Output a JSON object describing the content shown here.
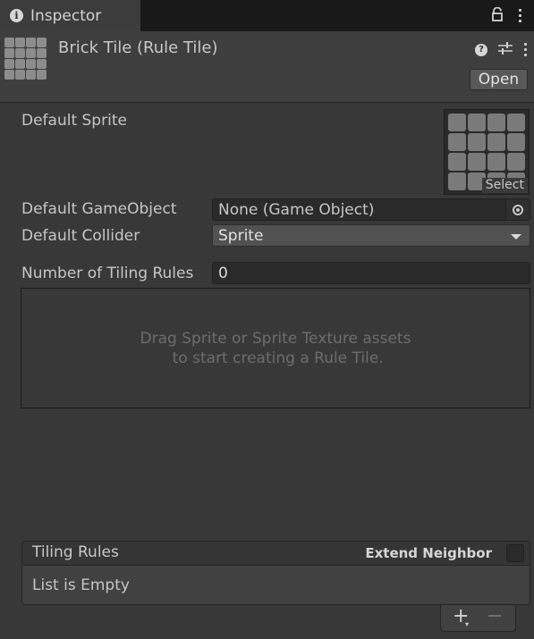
{
  "tab": {
    "title": "Inspector"
  },
  "header": {
    "asset_title": "Brick Tile (Rule Tile)",
    "help_icon_glyph": "?",
    "open_label": "Open"
  },
  "default_sprite": {
    "label": "Default Sprite",
    "select_label": "Select"
  },
  "default_gameobject": {
    "label": "Default GameObject",
    "value": "None (Game Object)"
  },
  "default_collider": {
    "label": "Default Collider",
    "value": "Sprite"
  },
  "tiling_rules_count": {
    "label": "Number of Tiling Rules",
    "value": "0"
  },
  "drop_area": {
    "text": "Drag Sprite or Sprite Texture assets\n to start creating a Rule Tile."
  },
  "rules_list": {
    "title": "Tiling Rules",
    "extend_neighbor_label": "Extend Neighbor",
    "empty_text": "List is Empty",
    "add_label": "+",
    "add_caret": "▾",
    "remove_label": "−"
  },
  "colors": {
    "background": "#383838",
    "tab_bar": "#191919",
    "field_dark": "#2a2a2a",
    "dropdown": "#515151",
    "text": "#c6c6c6",
    "hint_text": "#6d6d6d"
  }
}
